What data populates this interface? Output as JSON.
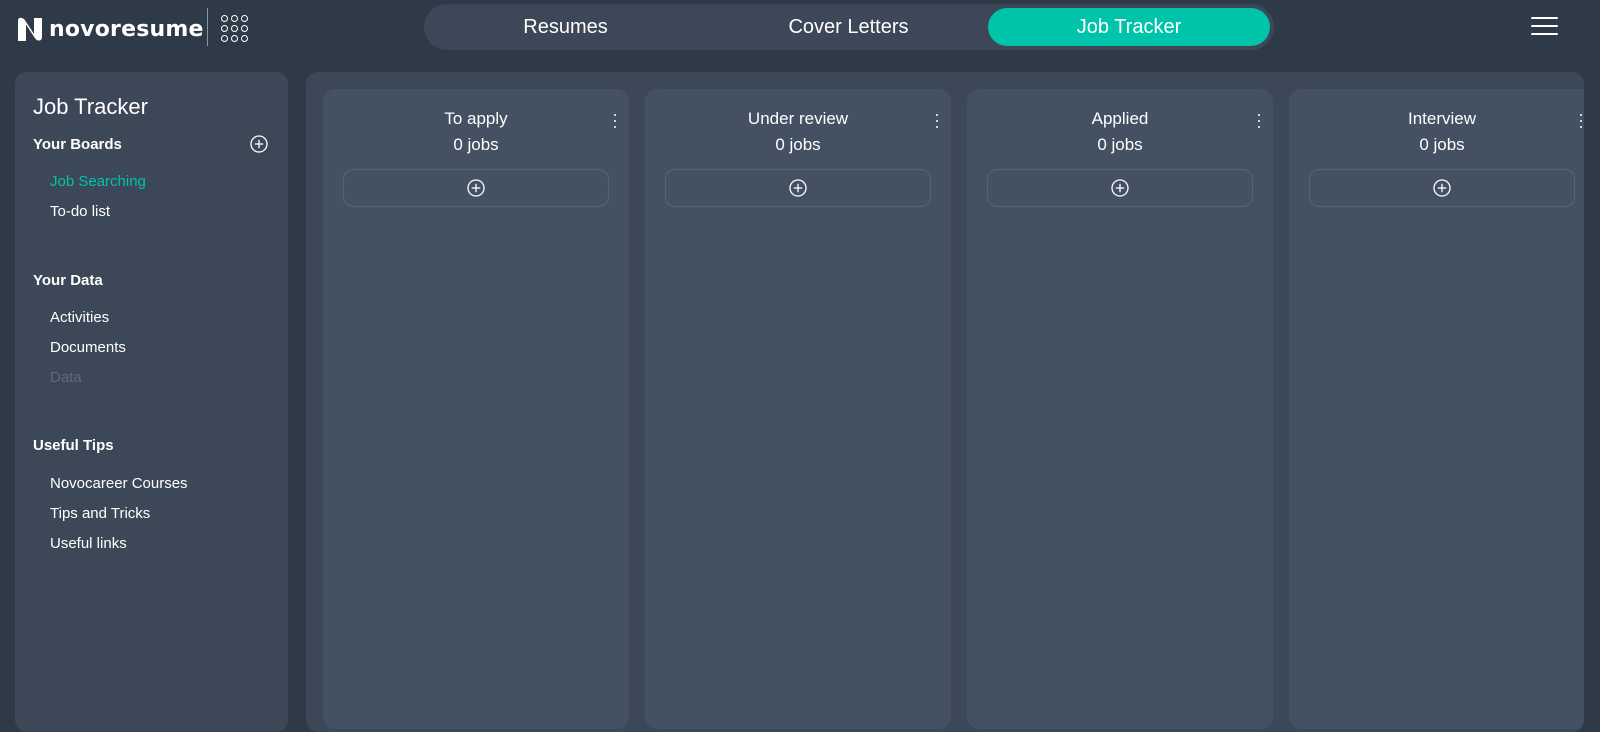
{
  "brand": {
    "name": "novoresume"
  },
  "icons": {
    "apps": "apps-grid-icon",
    "menu": "hamburger-menu-icon",
    "add": "plus-circle-icon",
    "more": "more-vertical-icon"
  },
  "colors": {
    "accent": "#00c4a9",
    "background": "#2f3a48",
    "panel": "#3c4757",
    "column": "#445163"
  },
  "nav": {
    "tabs": [
      {
        "label": "Resumes"
      },
      {
        "label": "Cover Letters"
      },
      {
        "label": "Job Tracker",
        "active": true
      }
    ]
  },
  "sidebar": {
    "title": "Job Tracker",
    "boards": {
      "heading": "Your Boards",
      "items": [
        {
          "label": "Job Searching",
          "active": true
        },
        {
          "label": "To-do list"
        }
      ]
    },
    "data": {
      "heading": "Your Data",
      "items": [
        {
          "label": "Activities"
        },
        {
          "label": "Documents"
        },
        {
          "label": "Data",
          "disabled": true
        }
      ]
    },
    "tips": {
      "heading": "Useful Tips",
      "items": [
        {
          "label": "Novocareer Courses"
        },
        {
          "label": "Tips and Tricks"
        },
        {
          "label": "Useful links"
        }
      ]
    }
  },
  "board": {
    "columns": [
      {
        "title": "To apply",
        "count": "0 jobs"
      },
      {
        "title": "Under review",
        "count": "0 jobs"
      },
      {
        "title": "Applied",
        "count": "0 jobs"
      },
      {
        "title": "Interview",
        "count": "0 jobs"
      }
    ]
  }
}
